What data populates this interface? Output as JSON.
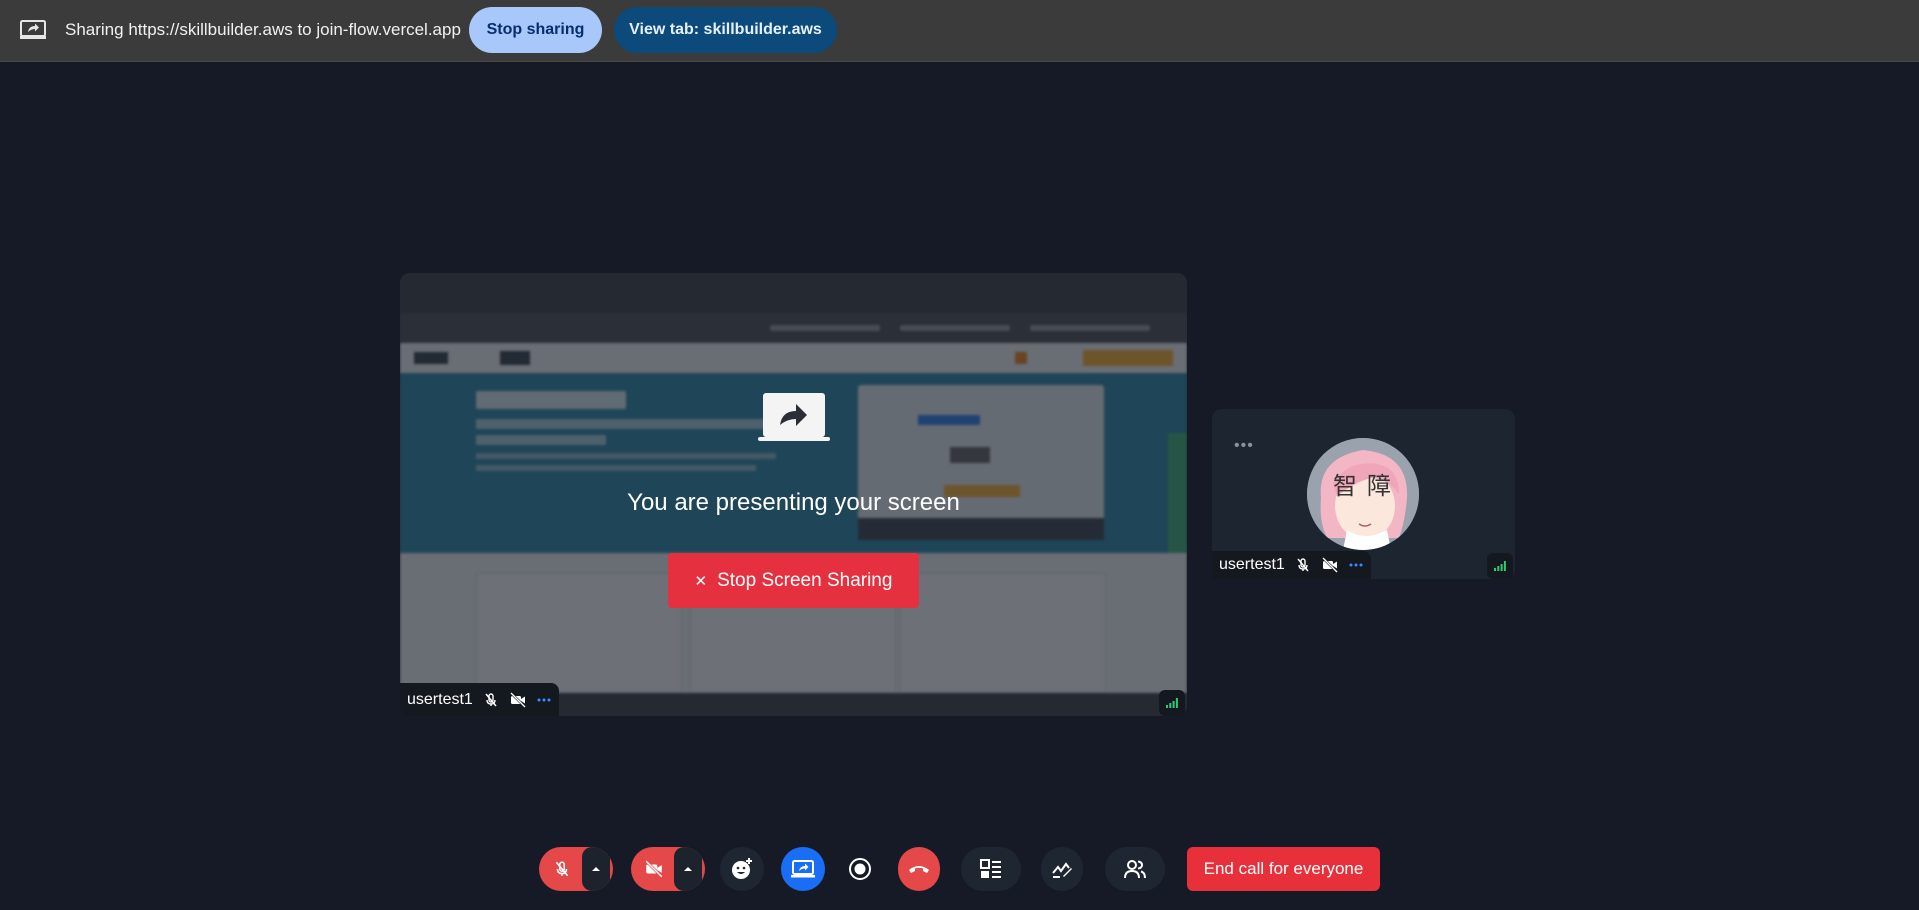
{
  "share_bar": {
    "icon": "tab-share-icon",
    "text": "Sharing https://skillbuilder.aws to join-flow.vercel.app",
    "stop_sharing_label": "Stop sharing",
    "view_tab_label": "View tab: skillbuilder.aws"
  },
  "main_tile": {
    "preview_page": "AWS Skill Builder",
    "present_icon": "present-screen-icon",
    "presenting_text": "You are presenting your screen",
    "stop_screen_label": "Stop Screen Sharing",
    "stop_screen_icon": "close-icon",
    "participant": {
      "name": "usertest1",
      "icons": [
        "mic-off-icon",
        "camera-off-icon",
        "more-icon"
      ]
    },
    "signal_icon": "signal-icon"
  },
  "self_tile": {
    "more_icon": "more-icon",
    "avatar": "avatar",
    "participant": {
      "name": "usertest1",
      "icons": [
        "mic-off-icon",
        "camera-off-icon",
        "more-icon"
      ]
    },
    "signal_icon": "signal-icon"
  },
  "controls": {
    "buttons": [
      "mic-toggle",
      "camera-toggle",
      "reactions",
      "screen-share",
      "record",
      "leave-call",
      "layout",
      "whiteboard",
      "participants"
    ],
    "end_call_label": "End call for everyone"
  },
  "colors": {
    "background": "#161a26",
    "share_bar": "#3b3b3b",
    "stop_sharing": "#a8c7fa",
    "view_tab": "#0b4a7a",
    "danger": "#e5303f",
    "screen_share_active": "#1a6ef5",
    "signal_green": "#2ecc71"
  }
}
